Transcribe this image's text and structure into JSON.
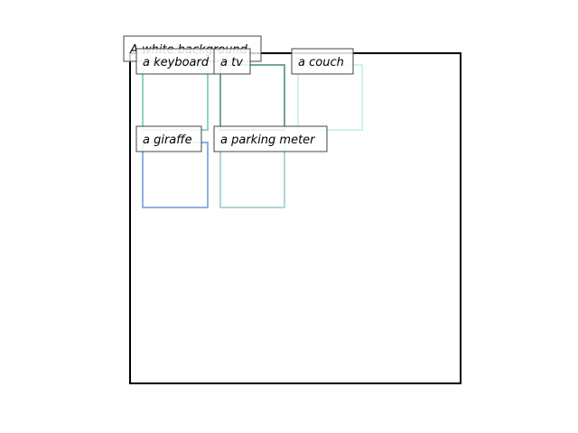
{
  "background_caption": "A white background",
  "boxes": [
    {
      "label": "a keyboard",
      "color": "#8fd3bf"
    },
    {
      "label": "a tv",
      "color": "#6fa69a"
    },
    {
      "label": "a couch",
      "color": "#cdf2ec"
    },
    {
      "label": "a giraffe",
      "color": "#8fb1e3"
    },
    {
      "label": "a parking meter",
      "color": "#acd6d6"
    }
  ]
}
